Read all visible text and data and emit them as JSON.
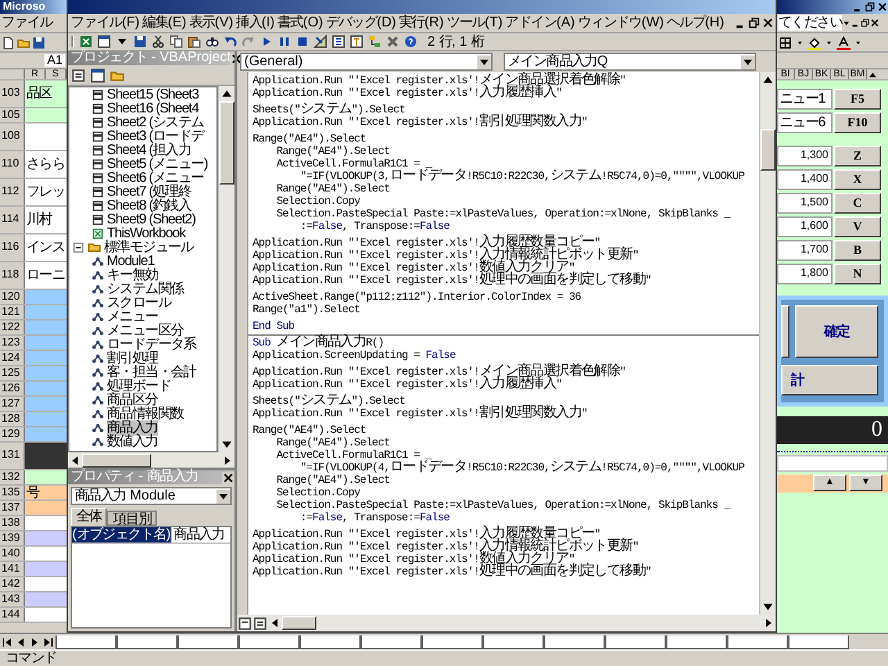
{
  "excel": {
    "title": "Microso",
    "menu": [
      "ファイル"
    ],
    "name_box": "A1",
    "left_columns": [
      "R",
      "S"
    ],
    "left_rows": [
      {
        "number": "103",
        "kind": "tall",
        "color": "#ccffcc",
        "text": "品区"
      },
      {
        "number": "105",
        "kind": "short",
        "color": "#ccffcc"
      },
      {
        "number": "108",
        "kind": "tall",
        "color": "#ffffff"
      },
      {
        "number": "110",
        "kind": "tall",
        "color": "#ffffff",
        "text": "さらら"
      },
      {
        "number": "112",
        "kind": "tall",
        "color": "#ffffff",
        "text": "フレッ"
      },
      {
        "number": "114",
        "kind": "tall",
        "color": "#ffffff",
        "text": "川村"
      },
      {
        "number": "116",
        "kind": "tall",
        "color": "#ffffff",
        "text": "インス"
      },
      {
        "number": "118",
        "kind": "tall",
        "color": "#ffffff",
        "text": "ローニ"
      },
      {
        "number": "120",
        "kind": "short",
        "color": "#99ccff"
      },
      {
        "number": "121",
        "kind": "short",
        "color": "#99ccff"
      },
      {
        "number": "122",
        "kind": "short",
        "color": "#99ccff"
      },
      {
        "number": "123",
        "kind": "short",
        "color": "#99ccff"
      },
      {
        "number": "124",
        "kind": "short",
        "color": "#99ccff"
      },
      {
        "number": "125",
        "kind": "short",
        "color": "#99ccff"
      },
      {
        "number": "126",
        "kind": "short",
        "color": "#99ccff"
      },
      {
        "number": "127",
        "kind": "short",
        "color": "#99ccff"
      },
      {
        "number": "128",
        "kind": "short",
        "color": "#99ccff"
      },
      {
        "number": "129",
        "kind": "short",
        "color": "#99ccff"
      },
      {
        "number": "131",
        "kind": "tall",
        "color": "#333333"
      },
      {
        "number": "132",
        "kind": "short",
        "color": "#ccffcc"
      },
      {
        "number": "135",
        "kind": "short",
        "color": "#ffcc99",
        "text": "号"
      },
      {
        "number": "137",
        "kind": "short",
        "color": "#ffcc99"
      },
      {
        "number": "138",
        "kind": "short",
        "color": "#ffffff"
      },
      {
        "number": "139",
        "kind": "short",
        "color": "#ccccff"
      },
      {
        "number": "140",
        "kind": "short",
        "color": "#ffffff"
      },
      {
        "number": "141",
        "kind": "short",
        "color": "#ccccff"
      },
      {
        "number": "142",
        "kind": "short",
        "color": "#ffffff"
      },
      {
        "number": "143",
        "kind": "short",
        "color": "#ccccff"
      },
      {
        "number": "144",
        "kind": "short",
        "color": "#ffffff"
      }
    ],
    "help_box": "てください",
    "right_columns": [
      "BI",
      "BJ",
      "BK",
      "BL",
      "BM"
    ],
    "menu_keys": [
      {
        "label": "ニュー1",
        "key": "F5"
      },
      {
        "label": "ニュー6",
        "key": "F10"
      }
    ],
    "amount_keys": [
      {
        "amount": "1,300",
        "key": "Z"
      },
      {
        "amount": "1,400",
        "key": "X"
      },
      {
        "amount": "1,500",
        "key": "C"
      },
      {
        "amount": "1,600",
        "key": "V"
      },
      {
        "amount": "1,700",
        "key": "B"
      },
      {
        "amount": "1,800",
        "key": "N"
      }
    ],
    "confirm_button": "確定",
    "total_button": "計",
    "display": "0",
    "scroll_buttons": [
      "▲",
      "▼"
    ],
    "status_bar": "コマンド"
  },
  "vbe": {
    "menu": [
      "ファイル(F)",
      "編集(E)",
      "表示(V)",
      "挿入(I)",
      "書式(O)",
      "デバッグ(D)",
      "実行(R)",
      "ツール(T)",
      "アドイン(A)",
      "ウィンドウ(W)",
      "ヘルプ(H)"
    ],
    "position": "2 行, 1 桁",
    "project": {
      "title": "プロジェクト - VBAProject",
      "tree": [
        {
          "kind": "folder",
          "children": [
            {
              "label": "Sheet15 (Sheet3",
              "kind": "sheet",
              "selected": false
            },
            {
              "label": "Sheet16 (Sheet4",
              "kind": "sheet",
              "selected": false
            },
            {
              "label": "Sheet2 (システム",
              "kind": "sheet",
              "selected": false
            },
            {
              "label": "Sheet3 (ロードデ",
              "kind": "sheet",
              "selected": false
            },
            {
              "label": "Sheet4 (担入力",
              "kind": "sheet",
              "selected": false
            },
            {
              "label": "Sheet5 (メニュー)",
              "kind": "sheet",
              "selected": false
            },
            {
              "label": "Sheet6 (メニュー",
              "kind": "sheet",
              "selected": false
            },
            {
              "label": "Sheet7 (処理終",
              "kind": "sheet",
              "selected": false
            },
            {
              "label": "Sheet8 (釣銭入",
              "kind": "sheet",
              "selected": false
            },
            {
              "label": "Sheet9 (Sheet2)",
              "kind": "sheet",
              "selected": false
            },
            {
              "label": "ThisWorkbook",
              "kind": "workbook",
              "selected": false
            }
          ]
        },
        {
          "label": "標準モジュール",
          "kind": "folder",
          "expanded": true,
          "children": [
            {
              "label": "Module1",
              "kind": "module",
              "selected": false
            },
            {
              "label": "キー無効",
              "kind": "module",
              "selected": false
            },
            {
              "label": "システム関係",
              "kind": "module",
              "selected": false
            },
            {
              "label": "スクロール",
              "kind": "module",
              "selected": false
            },
            {
              "label": "メニュー",
              "kind": "module",
              "selected": false
            },
            {
              "label": "メニュー区分",
              "kind": "module",
              "selected": false
            },
            {
              "label": "ロードデータ系",
              "kind": "module",
              "selected": false
            },
            {
              "label": "割引処理",
              "kind": "module",
              "selected": false
            },
            {
              "label": "客・担当・会計",
              "kind": "module",
              "selected": false
            },
            {
              "label": "処理ボード",
              "kind": "module",
              "selected": false
            },
            {
              "label": "商品区分",
              "kind": "module",
              "selected": false
            },
            {
              "label": "商品情報関数",
              "kind": "module",
              "selected": false
            },
            {
              "label": "商品入力",
              "kind": "module",
              "selected": true
            },
            {
              "label": "数値入力",
              "kind": "module",
              "selected": false
            }
          ]
        }
      ]
    },
    "properties": {
      "title": "プロパティ - 商品入力",
      "object": "商品入力 Module",
      "tabs": [
        {
          "label": "全体",
          "selected": true
        },
        {
          "label": "項目別",
          "selected": false
        }
      ],
      "rows": [
        {
          "name": "(オブジェクト名)",
          "value": "商品入力",
          "selected": true
        }
      ]
    },
    "code": {
      "object": "(General)",
      "procedure": "メイン商品入力Q",
      "procedures": [
        {
          "blocks": [
            [
              "Application.Run \"'Excel register.xls'!メイン商品選択着色解除\"",
              "Application.Run \"'Excel register.xls'!入力履歴挿入\""
            ],
            [
              "Sheets(\"システム\").Select",
              "Application.Run \"'Excel register.xls'!割引処理関数入力\""
            ],
            [
              "Range(\"AE4\").Select",
              "    Range(\"AE4\").Select",
              "    ActiveCell.FormulaR1C1 = _",
              "        \"=IF(VLOOKUP(3,ロードデータ!R5C10:R22C30,システム!R5C74,0)=0,\"\"\"\",VLOOKUP",
              "    Range(\"AE4\").Select",
              "    Selection.Copy",
              "    Selection.PasteSpecial Paste:=xlPasteValues, Operation:=xlNone, SkipBlanks _",
              [
                "        :=",
                {
                  "text": "False",
                  "kind": "keyword"
                },
                ", Transpose:=",
                {
                  "text": "False",
                  "kind": "keyword"
                }
              ]
            ],
            [
              "Application.Run \"'Excel register.xls'!入力履歴数量コピー\"",
              "Application.Run \"'Excel register.xls'!入力情報統計ピボット更新\"",
              "Application.Run \"'Excel register.xls'!数値入力クリア\"",
              "Application.Run \"'Excel register.xls'!処理中の画面を判定して移動\""
            ],
            [
              "ActiveSheet.Range(\"p112:z112\").Interior.ColorIndex = 36",
              "Range(\"a1\").Select"
            ],
            [
              [
                {
                  "text": "End Sub",
                  "kind": "keyword"
                }
              ]
            ]
          ]
        },
        {
          "blocks": [
            [
              [
                {
                  "text": "Sub",
                  "kind": "keyword"
                },
                " メイン商品入力R()"
              ],
              [
                "Application.ScreenUpdating = ",
                {
                  "text": "False",
                  "kind": "keyword"
                }
              ]
            ],
            [
              "Application.Run \"'Excel register.xls'!メイン商品選択着色解除\"",
              "Application.Run \"'Excel register.xls'!入力履歴挿入\""
            ],
            [
              "Sheets(\"システム\").Select",
              "Application.Run \"'Excel register.xls'!割引処理関数入力\""
            ],
            [
              "Range(\"AE4\").Select",
              "    Range(\"AE4\").Select",
              "    ActiveCell.FormulaR1C1 = _",
              "        \"=IF(VLOOKUP(4,ロードデータ!R5C10:R22C30,システム!R5C74,0)=0,\"\"\"\",VLOOKUP",
              "    Range(\"AE4\").Select",
              "    Selection.Copy",
              "    Selection.PasteSpecial Paste:=xlPasteValues, Operation:=xlNone, SkipBlanks _",
              [
                "        :=",
                {
                  "text": "False",
                  "kind": "keyword"
                },
                ", Transpose:=",
                {
                  "text": "False",
                  "kind": "keyword"
                }
              ]
            ],
            [
              "Application.Run \"'Excel register.xls'!入力履歴数量コピー\"",
              "Application.Run \"'Excel register.xls'!入力情報統計ピボット更新\"",
              "Application.Run \"'Excel register.xls'!数値入力クリア\"",
              "Application.Run \"'Excel register.xls'!処理中の画面を判定して移動\""
            ]
          ]
        }
      ]
    }
  }
}
